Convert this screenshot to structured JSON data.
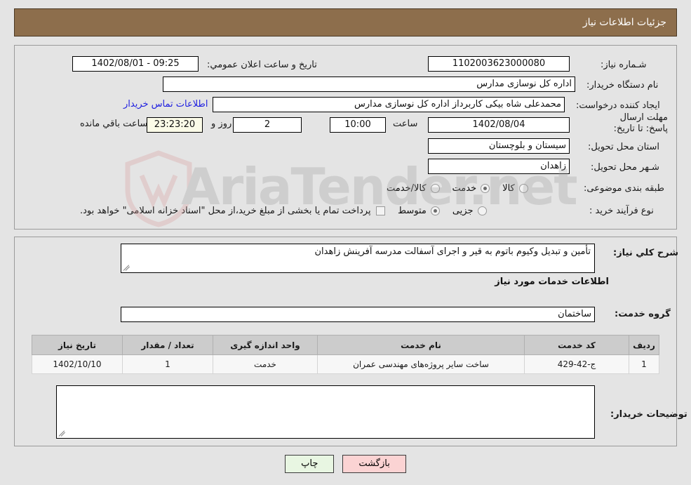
{
  "header": {
    "title": "جزئیات اطلاعات نیاز"
  },
  "need_info": {
    "need_number_label": "شـماره نیاز:",
    "need_number_value": "1102003623000080",
    "announce_datetime_label": "تاریخ و ساعت اعلان عمومي:",
    "announce_datetime_value": "09:25 - 1402/08/01",
    "buyer_org_label": "نام دستگاه خریدار:",
    "buyer_org_value": "اداره کل نوسازی مدارس",
    "request_creator_label": "ایجاد کننده درخواست:",
    "request_creator_value": "محمدعلی شاه بیکی کاربرداز اداره کل نوسازی مدارس",
    "buyer_contact_link": "اطلاعات تماس خریدار",
    "deadline_label": "مهلت ارسال پاسخ: تا تاریخ:",
    "deadline_date_value": "1402/08/04",
    "deadline_hour_label": "ساعت",
    "deadline_hour_value": "10:00",
    "remaining_days_value": "2",
    "remaining_days_label": "روز و",
    "remaining_time_value": "23:23:20",
    "remaining_time_label": "ساعت باقي مانده",
    "province_label": "استان محل تحویل:",
    "province_value": "سیستان و بلوچستان",
    "city_label": "شـهر محل تحویل:",
    "city_value": "زاهدان",
    "category_label": "طبقه بندی موضوعی:",
    "category_options": [
      {
        "label": "کالا",
        "selected": false
      },
      {
        "label": "خدمت",
        "selected": true
      },
      {
        "label": "کالا/خدمت",
        "selected": false
      }
    ],
    "process_label": "نوع فرآیند خرید :",
    "process_options": [
      {
        "label": "جزیی",
        "selected": false
      },
      {
        "label": "متوسط",
        "selected": true
      }
    ],
    "treasury_checkbox_checked": false,
    "treasury_text": "پرداخت تمام یا بخشی از مبلغ خرید،از محل \"اسناد خزانه اسلامی\" خواهد بود."
  },
  "details": {
    "general_desc_label": "شرح کلي نیاز:",
    "general_desc_value": "تأمین و تبدیل وکیوم باتوم به قیر و اجرای آسفالت مدرسه آفرینش زاهدان",
    "services_section_heading": "اطلاعات خدمات مورد نیاز",
    "service_group_label": "گروه خدمت:",
    "service_group_value": "ساختمان",
    "buyer_notes_label": "توضیحات خریدار:",
    "buyer_notes_value": ""
  },
  "table": {
    "headers": [
      "ردیف",
      "کد خدمت",
      "نام خدمت",
      "واحد اندازه گیری",
      "تعداد / مقدار",
      "تاریخ نیاز"
    ],
    "rows": [
      {
        "index": "1",
        "service_code": "ج-42-429",
        "service_name": "ساخت سایر پروژه‌های مهندسی عمران",
        "unit": "خدمت",
        "quantity": "1",
        "need_date": "1402/10/10"
      }
    ]
  },
  "footer": {
    "print_label": "چاپ",
    "back_label": "بازگشت"
  },
  "watermark": {
    "text": "AriaTender.net"
  },
  "colors": {
    "header_bg": "#8d6e4c",
    "page_bg": "#e4e4e4",
    "link": "#2020e0",
    "print_btn": "#e8f6e2",
    "back_btn": "#fbd3d3",
    "table_header": "#cccccc",
    "countdown_bg": "#fbfbe8"
  }
}
